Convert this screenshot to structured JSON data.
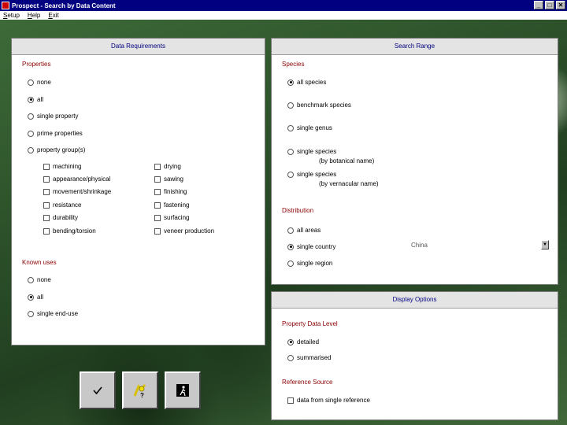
{
  "window": {
    "title": "Prospect - Search by Data Content"
  },
  "menu": [
    "Setup",
    "Help",
    "Exit"
  ],
  "data_requirements": {
    "header": "Data Requirements",
    "properties_label": "Properties",
    "properties_options": [
      "none",
      "all",
      "single property",
      "prime properties",
      "property group(s)"
    ],
    "properties_selected": "all",
    "groups_left": [
      "machining",
      "appearance/physical",
      "movement/shrinkage",
      "resistance",
      "durability",
      "bending/torsion"
    ],
    "groups_right": [
      "drying",
      "sawing",
      "finishing",
      "fastening",
      "surfacing",
      "veneer production"
    ],
    "known_uses_label": "Known uses",
    "known_uses_options": [
      "none",
      "all",
      "single end-use"
    ],
    "known_uses_selected": "all"
  },
  "search_range": {
    "header": "Search Range",
    "species_label": "Species",
    "species_options": [
      "all species",
      "benchmark species",
      "single genus",
      "single species",
      "single species"
    ],
    "species_sublabels": [
      "(by botanical name)",
      "(by vernacular name)"
    ],
    "species_selected": "all species",
    "distribution_label": "Distribution",
    "distribution_options": [
      "all areas",
      "single country",
      "single region"
    ],
    "distribution_selected": "single country",
    "country_value": "China"
  },
  "display_options": {
    "header": "Display Options",
    "property_level_label": "Property Data Level",
    "property_level_options": [
      "detailed",
      "summarised"
    ],
    "property_level_selected": "detailed",
    "reference_label": "Reference Source",
    "reference_option": "data from single reference"
  },
  "toolbar": {
    "ok_icon": "checkmark-icon",
    "help_icon": "help-icon",
    "exit_icon": "exit-door-icon"
  }
}
